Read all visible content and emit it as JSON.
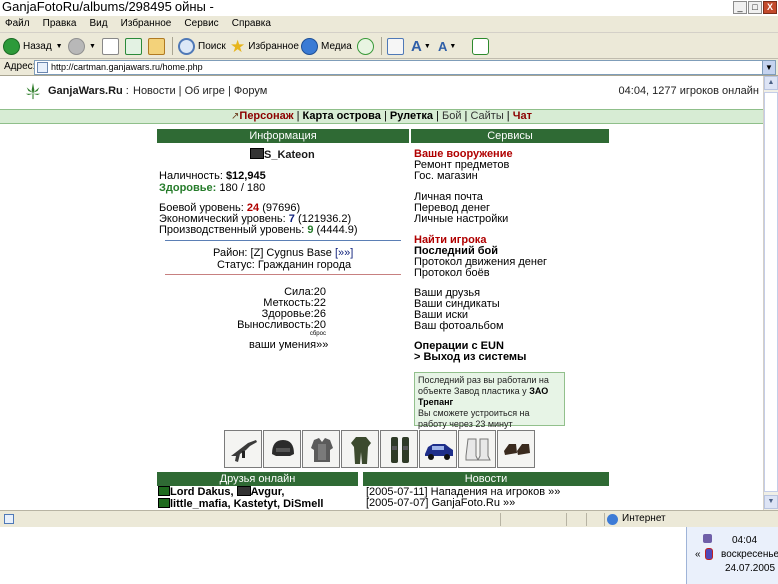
{
  "window": {
    "title": "GanjaFotoRu/albums/298495",
    "title_tail": "ойны -",
    "buttons": [
      "_",
      "□",
      "X"
    ]
  },
  "menu": [
    "Файл",
    "Правка",
    "Вид",
    "Избранное",
    "Сервис",
    "Справка"
  ],
  "toolbar": {
    "back": "Назад",
    "search": "Поиск",
    "favorites": "Избранное",
    "media": "Медиа"
  },
  "address": {
    "label": "Адрес:",
    "url": "http://cartman.ganjawars.ru/home.php"
  },
  "header": {
    "site_name": "GanjaWars.Ru",
    "sep": ":",
    "links": [
      "Новости",
      "Об игре",
      "Форум"
    ],
    "status": "04:04, 1277 игроков онлайн"
  },
  "nav": {
    "character": "Персонаж",
    "island_map": "Карта острова",
    "roulette": "Рулетка",
    "battle": "Бой",
    "sites": "Сайты",
    "chat": "Чат"
  },
  "info": {
    "heading": "Информация",
    "player_name": "S_Kateon",
    "cash_label": "Наличность:",
    "cash_value": "$12,945",
    "health_label": "Здоровье:",
    "health_value": "180 / 180",
    "combat_label": "Боевой уровень:",
    "combat_level": "24",
    "combat_exp": "(97696)",
    "econ_label": "Экономический уровень:",
    "econ_level": "7",
    "econ_exp": "(121936.2)",
    "prod_label": "Производственный уровень:",
    "prod_level": "9",
    "prod_exp": "(4444.9)",
    "district_label": "Район:",
    "district_value": "[Z] Cygnus Base",
    "district_link": "[»»]",
    "status_label": "Статус:",
    "status_value": "Гражданин города",
    "stats": [
      {
        "label": "Сила:",
        "value": "20"
      },
      {
        "label": "Меткость:",
        "value": "22"
      },
      {
        "label": "Здоровье:",
        "value": "26"
      },
      {
        "label": "Выносливость:",
        "value": "20"
      }
    ],
    "reset": "сброс",
    "skills": "ваши умения»»"
  },
  "services": {
    "heading": "Сервисы",
    "your_weapons": "Ваше вооружение",
    "repair": "Ремонт предметов",
    "gov_shop": "Гос. магазин",
    "mail": "Личная почта",
    "money_transfer": "Перевод денег",
    "settings": "Личные настройки",
    "find_player": "Найти игрока",
    "last_battle": "Последний бой",
    "money_log": "Протокол движения денег",
    "battle_log": "Протокол боёв",
    "friends": "Ваши друзья",
    "syndicates": "Ваши синдикаты",
    "lawsuits": "Ваши иски",
    "photo_album": "Ваш фотоальбом",
    "eun_ops": "Операции с EUN",
    "logout": "> Выход из системы"
  },
  "job": {
    "line1": "Последний раз вы работали на",
    "line2": "объекте Завод пластика у",
    "company": "ЗАО Трепанг",
    "line3": "Вы сможете устроиться на",
    "line4": "работу через 23 минут"
  },
  "items": [
    {
      "icon": "rifle-icon"
    },
    {
      "icon": "helmet-icon"
    },
    {
      "icon": "armor-vest-icon"
    },
    {
      "icon": "suit-icon"
    },
    {
      "icon": "leg-armor-icon"
    },
    {
      "icon": "car-icon"
    },
    {
      "icon": "boots-icon"
    },
    {
      "icon": "shoes-icon"
    }
  ],
  "friends": {
    "heading": "Друзья онлайн",
    "names_line1": [
      "Lord Dakus",
      "Avgur"
    ],
    "names_line2": "little_mafia, Kastetyt, DiSmell"
  },
  "news": {
    "heading": "Новости",
    "items": [
      {
        "date": "[2005-07-11]",
        "title": "Нападения на игроков »»"
      },
      {
        "date": "[2005-07-07]",
        "title": "GanjaFoto.Ru »»"
      }
    ]
  },
  "statusbar": {
    "zone": "Интернет"
  },
  "tray": {
    "time": "04:04",
    "day": "воскресенье",
    "date": "24.07.2005",
    "chevron": "«"
  },
  "colors": {
    "panel_header": "#2f6a34",
    "nav_bg": "#d7ecd4",
    "accent_red": "#b00000",
    "accent_green": "#267c2b",
    "accent_blue": "#0d1f7a"
  }
}
